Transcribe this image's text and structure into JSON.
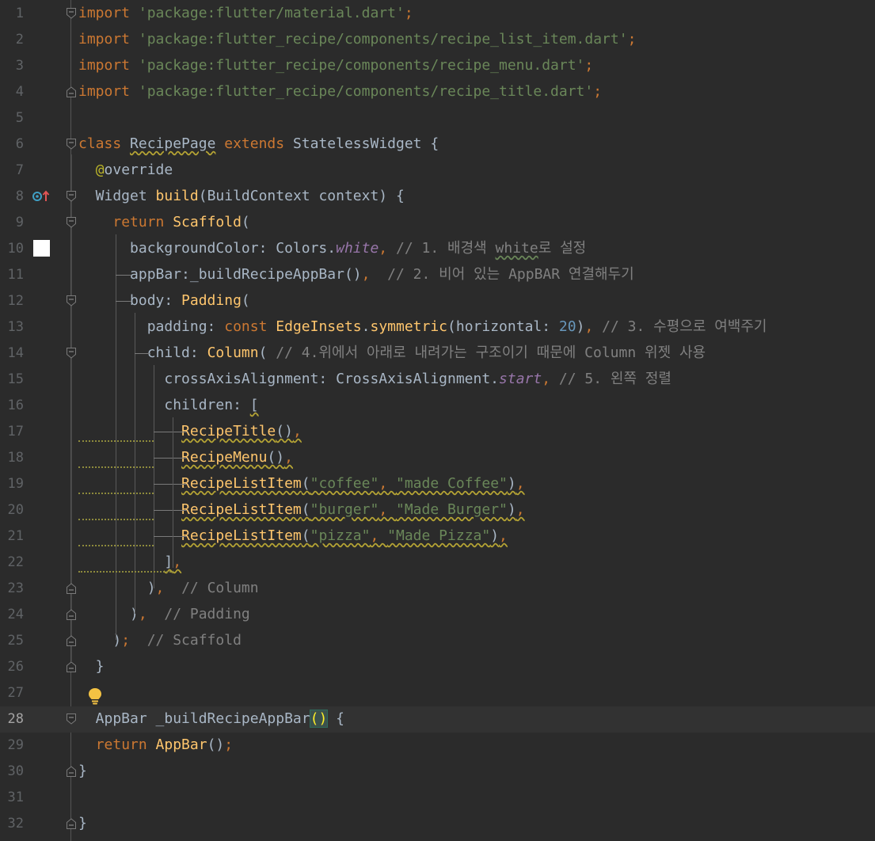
{
  "editor": {
    "theme_colors": {
      "background": "#2b2b2b",
      "keyword": "#cc7832",
      "string": "#6a8759",
      "function": "#ffc66d",
      "comment": "#808080",
      "number": "#6897bb",
      "annotation": "#bbb529",
      "property": "#9876aa"
    },
    "current_line": 28,
    "icons": {
      "line8": "override-method-icon",
      "line10": "white-color-swatch-icon",
      "line27": "lightbulb-intention-icon"
    },
    "lines": [
      {
        "n": "1",
        "t": [
          [
            "kw",
            "import "
          ],
          [
            "str",
            "'package:flutter/material.dart'"
          ],
          [
            "pun",
            ";"
          ]
        ]
      },
      {
        "n": "2",
        "t": [
          [
            "kw",
            "import "
          ],
          [
            "str",
            "'package:flutter_recipe/components/recipe_list_item.dart'"
          ],
          [
            "pun",
            ";"
          ]
        ]
      },
      {
        "n": "3",
        "t": [
          [
            "kw",
            "import "
          ],
          [
            "str",
            "'package:flutter_recipe/components/recipe_menu.dart'"
          ],
          [
            "pun",
            ";"
          ]
        ]
      },
      {
        "n": "4",
        "t": [
          [
            "kw",
            "import "
          ],
          [
            "str",
            "'package:flutter_recipe/components/recipe_title.dart'"
          ],
          [
            "pun",
            ";"
          ]
        ]
      },
      {
        "n": "5",
        "t": []
      },
      {
        "n": "6",
        "t": [
          [
            "kw",
            "class "
          ],
          [
            "cls wavy",
            "RecipePage"
          ],
          [
            "cls",
            " "
          ],
          [
            "kw",
            "extends "
          ],
          [
            "cls",
            "StatelessWidget {"
          ]
        ]
      },
      {
        "n": "7",
        "t": [
          [
            "cls",
            "  "
          ],
          [
            "ann",
            "@"
          ],
          [
            "cls",
            "override"
          ]
        ]
      },
      {
        "n": "8",
        "t": [
          [
            "cls",
            "  Widget "
          ],
          [
            "fn",
            "build"
          ],
          [
            "cls",
            "(BuildContext context) {"
          ]
        ]
      },
      {
        "n": "9",
        "t": [
          [
            "cls",
            "    "
          ],
          [
            "kw",
            "return "
          ],
          [
            "fn",
            "Scaffold"
          ],
          [
            "cls",
            "("
          ]
        ]
      },
      {
        "n": "10",
        "t": [
          [
            "cls",
            "      backgroundColor: Colors."
          ],
          [
            "prop",
            "white"
          ],
          [
            "pun",
            ", "
          ],
          [
            "cm",
            "// 1. 배경색 "
          ],
          [
            "cm wavy-green",
            "white"
          ],
          [
            "cm",
            "로 설정"
          ]
        ]
      },
      {
        "n": "11",
        "t": [
          [
            "cls",
            "      appBar:_buildRecipeAppBar()"
          ],
          [
            "pun",
            ",  "
          ],
          [
            "cm",
            "// 2. 비어 있는 AppBAR 연결해두기"
          ]
        ]
      },
      {
        "n": "12",
        "t": [
          [
            "cls",
            "      body: "
          ],
          [
            "fn",
            "Padding"
          ],
          [
            "cls",
            "("
          ]
        ]
      },
      {
        "n": "13",
        "t": [
          [
            "cls",
            "        padding: "
          ],
          [
            "kw",
            "const "
          ],
          [
            "fn",
            "EdgeInsets"
          ],
          [
            "cls",
            "."
          ],
          [
            "fn",
            "symmetric"
          ],
          [
            "cls",
            "(horizontal: "
          ],
          [
            "num",
            "20"
          ],
          [
            "cls",
            ")"
          ],
          [
            "pun",
            ", "
          ],
          [
            "cm",
            "// 3. 수평으로 여백주기"
          ]
        ]
      },
      {
        "n": "14",
        "t": [
          [
            "cls",
            "        child: "
          ],
          [
            "fn",
            "Column"
          ],
          [
            "cls",
            "( "
          ],
          [
            "cm",
            "// 4.위에서 아래로 내려가는 구조이기 때문에 Column 위젯 사용"
          ]
        ]
      },
      {
        "n": "15",
        "t": [
          [
            "cls",
            "          crossAxisAlignment: CrossAxisAlignment."
          ],
          [
            "prop",
            "start"
          ],
          [
            "pun",
            ", "
          ],
          [
            "cm",
            "// 5. 왼쪽 정렬"
          ]
        ]
      },
      {
        "n": "16",
        "t": [
          [
            "cls",
            "          children: "
          ],
          [
            "cls wavy",
            "["
          ]
        ]
      },
      {
        "n": "17",
        "t": [
          [
            "cls",
            "            "
          ],
          [
            "fn wavy",
            "RecipeTitle"
          ],
          [
            "cls wavy",
            "()"
          ],
          [
            "pun wavy",
            ","
          ]
        ]
      },
      {
        "n": "18",
        "t": [
          [
            "cls",
            "            "
          ],
          [
            "fn wavy",
            "RecipeMenu"
          ],
          [
            "cls wavy",
            "()"
          ],
          [
            "pun wavy",
            ","
          ]
        ]
      },
      {
        "n": "19",
        "t": [
          [
            "cls",
            "            "
          ],
          [
            "fn wavy",
            "RecipeListItem"
          ],
          [
            "cls wavy",
            "("
          ],
          [
            "str wavy",
            "\"coffee\""
          ],
          [
            "pun wavy",
            ", "
          ],
          [
            "str wavy",
            "\"made Coffee\""
          ],
          [
            "cls wavy",
            ")"
          ],
          [
            "pun wavy",
            ","
          ]
        ]
      },
      {
        "n": "20",
        "t": [
          [
            "cls",
            "            "
          ],
          [
            "fn wavy",
            "RecipeListItem"
          ],
          [
            "cls wavy",
            "("
          ],
          [
            "str wavy",
            "\"burger\""
          ],
          [
            "pun wavy",
            ", "
          ],
          [
            "str wavy",
            "\"Made Burger\""
          ],
          [
            "cls wavy",
            ")"
          ],
          [
            "pun wavy",
            ","
          ]
        ]
      },
      {
        "n": "21",
        "t": [
          [
            "cls",
            "            "
          ],
          [
            "fn wavy",
            "RecipeListItem"
          ],
          [
            "cls wavy",
            "("
          ],
          [
            "str wavy",
            "\"pizza\""
          ],
          [
            "pun wavy",
            ", "
          ],
          [
            "str wavy",
            "\"Made Pizza\""
          ],
          [
            "cls wavy",
            ")"
          ],
          [
            "pun wavy",
            ","
          ]
        ]
      },
      {
        "n": "22",
        "t": [
          [
            "cls",
            "          "
          ],
          [
            "cls wavy",
            "]"
          ],
          [
            "pun wavy",
            ","
          ]
        ]
      },
      {
        "n": "23",
        "t": [
          [
            "cls",
            "        )"
          ],
          [
            "pun",
            ",  "
          ],
          [
            "cm",
            "// Column"
          ]
        ]
      },
      {
        "n": "24",
        "t": [
          [
            "cls",
            "      )"
          ],
          [
            "pun",
            ",  "
          ],
          [
            "cm",
            "// Padding"
          ]
        ]
      },
      {
        "n": "25",
        "t": [
          [
            "cls",
            "    )"
          ],
          [
            "pun",
            ";  "
          ],
          [
            "cm",
            "// Scaffold"
          ]
        ]
      },
      {
        "n": "26",
        "t": [
          [
            "cls",
            "  }"
          ]
        ]
      },
      {
        "n": "27",
        "t": []
      },
      {
        "n": "28",
        "t": [
          [
            "cls",
            "  AppBar _buildRecipeAppBar"
          ],
          [
            "brace-match",
            "()"
          ],
          [
            "cls",
            " {"
          ]
        ]
      },
      {
        "n": "29",
        "t": [
          [
            "cls",
            "  "
          ],
          [
            "kw",
            "return "
          ],
          [
            "fn",
            "AppBar"
          ],
          [
            "cls",
            "()"
          ],
          [
            "pun",
            ";"
          ]
        ]
      },
      {
        "n": "30",
        "t": [
          [
            "cls",
            "}"
          ]
        ]
      },
      {
        "n": "31",
        "t": []
      },
      {
        "n": "32",
        "t": [
          [
            "cls",
            "}"
          ]
        ]
      }
    ]
  }
}
